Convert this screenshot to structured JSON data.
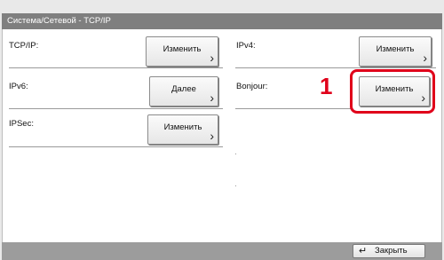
{
  "header": {
    "title": "Система/Сетевой - TCP/IP"
  },
  "rows": [
    {
      "label": "TCP/IP:",
      "button": "Изменить"
    },
    {
      "label": "IPv4:",
      "button": "Изменить"
    },
    {
      "label": "IPv6:",
      "button": "Далее"
    },
    {
      "label": "Bonjour:",
      "button": "Изменить"
    },
    {
      "label": "IPSec:",
      "button": "Изменить"
    }
  ],
  "callout": {
    "marker": "1",
    "color": "#e0001a"
  },
  "footer": {
    "close_label": "Закрыть",
    "close_icon": "return-arrow-icon"
  }
}
